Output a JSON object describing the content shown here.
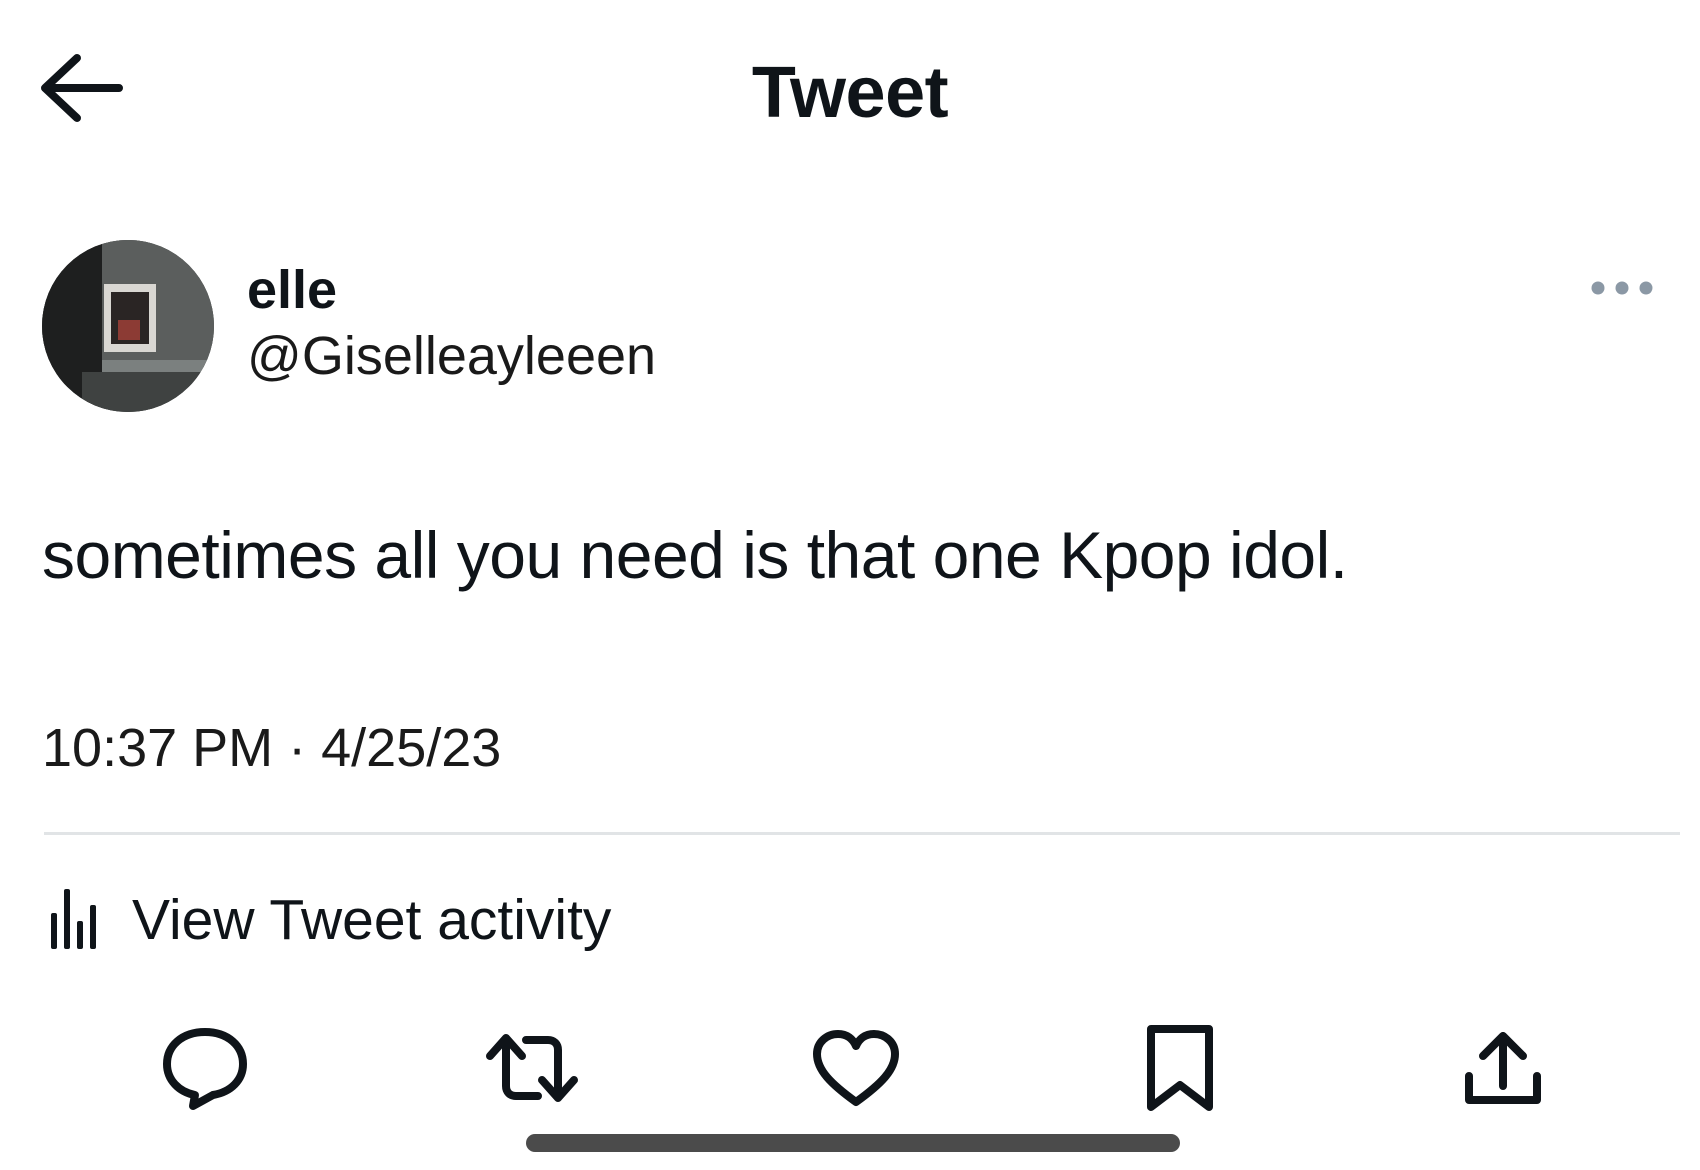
{
  "header": {
    "title": "Tweet",
    "back_icon": "arrow-left-icon"
  },
  "author": {
    "display_name": "elle",
    "handle": "@Giselleayleeen",
    "more_icon": "more-dots-icon"
  },
  "tweet": {
    "text": "sometimes all you need is that one Kpop idol.",
    "timestamp": "10:37 PM · 4/25/23"
  },
  "activity": {
    "label": "View Tweet activity",
    "icon": "bar-chart-icon"
  },
  "actions": [
    {
      "name": "reply",
      "icon": "reply-icon"
    },
    {
      "name": "retweet",
      "icon": "retweet-icon"
    },
    {
      "name": "like",
      "icon": "heart-icon"
    },
    {
      "name": "bookmark",
      "icon": "bookmark-icon"
    },
    {
      "name": "share",
      "icon": "share-icon"
    }
  ],
  "colors": {
    "text": "#0f1419",
    "divider": "#e1e4e6",
    "more_dots": "#8b98a5",
    "home_indicator": "#4b4b4b"
  }
}
